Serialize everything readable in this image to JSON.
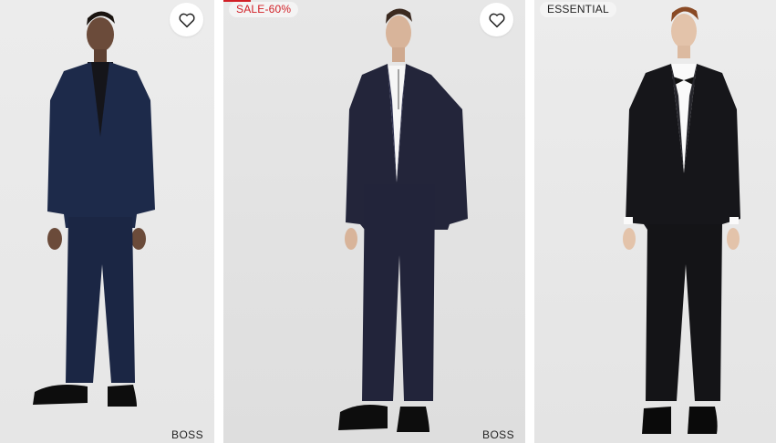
{
  "products": [
    {
      "brand": "BOSS",
      "badge": "",
      "wishlist_icon": "heart-outline-icon",
      "suit_color": "#1d2a4a",
      "shirt_color": "#15151a",
      "neck": "turtleneck"
    },
    {
      "brand": "BOSS",
      "badge": "SALE-60%",
      "wishlist_icon": "heart-outline-icon",
      "suit_color": "#23253a",
      "shirt_color": "#f6f6f6",
      "neck": "polo"
    },
    {
      "brand": "",
      "badge": "ESSENTIAL",
      "wishlist_icon": "",
      "suit_color": "#16161a",
      "shirt_color": "#fafafa",
      "neck": "bowtie"
    }
  ],
  "colors": {
    "sale_red": "#d11f26",
    "background": "#e8e8e8"
  }
}
